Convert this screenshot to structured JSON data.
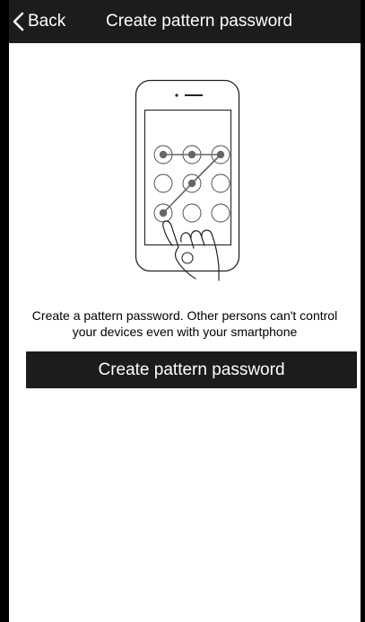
{
  "header": {
    "back_label": "Back",
    "title": "Create pattern password"
  },
  "icons": {
    "back": "chevron-left-icon",
    "illustration": "phone-pattern-lock-illustration"
  },
  "main": {
    "description_line1": "Create a pattern password. Other persons can't control",
    "description_line2": "your devices even with your smartphone",
    "create_button_label": "Create pattern password"
  },
  "colors": {
    "header_bg": "#1c1c1c",
    "button_bg": "#1c1c1c",
    "text_light": "#ffffff",
    "text_dark": "#000000",
    "pattern_dot": "#666666"
  }
}
